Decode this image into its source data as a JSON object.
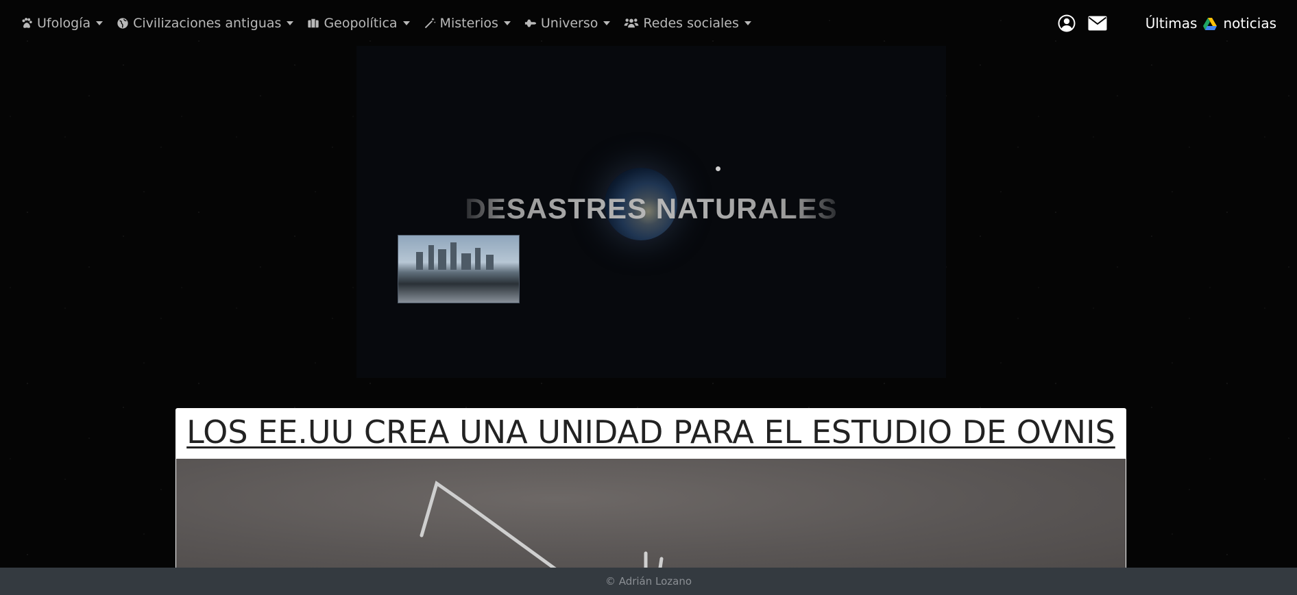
{
  "nav": {
    "items": [
      {
        "label": "Ufología",
        "icon": "paw-icon"
      },
      {
        "label": "Civilizaciones antiguas",
        "icon": "globe-icon"
      },
      {
        "label": "Geopolítica",
        "icon": "briefcase-icon"
      },
      {
        "label": "Misterios",
        "icon": "magic-wand-icon"
      },
      {
        "label": "Universo",
        "icon": "space-shuttle-icon"
      },
      {
        "label": "Redes sociales",
        "icon": "users-icon"
      }
    ],
    "right": {
      "user_icon": "user-circle-icon",
      "mail_icon": "envelope-icon",
      "latest_word1": "Últimas",
      "latest_icon": "google-drive-icon",
      "latest_word2": "noticias"
    }
  },
  "banner": {
    "title": "DESASTRES NATURALES"
  },
  "article": {
    "title": "LOS EE.UU CREA UNA UNIDAD PARA EL ESTUDIO DE OVNIS"
  },
  "footer": {
    "text": "© Adrián Lozano"
  },
  "colors": {
    "nav_text": "#b9b9b9",
    "footer_bg": "#343a40",
    "article_bg": "#ffffff"
  }
}
